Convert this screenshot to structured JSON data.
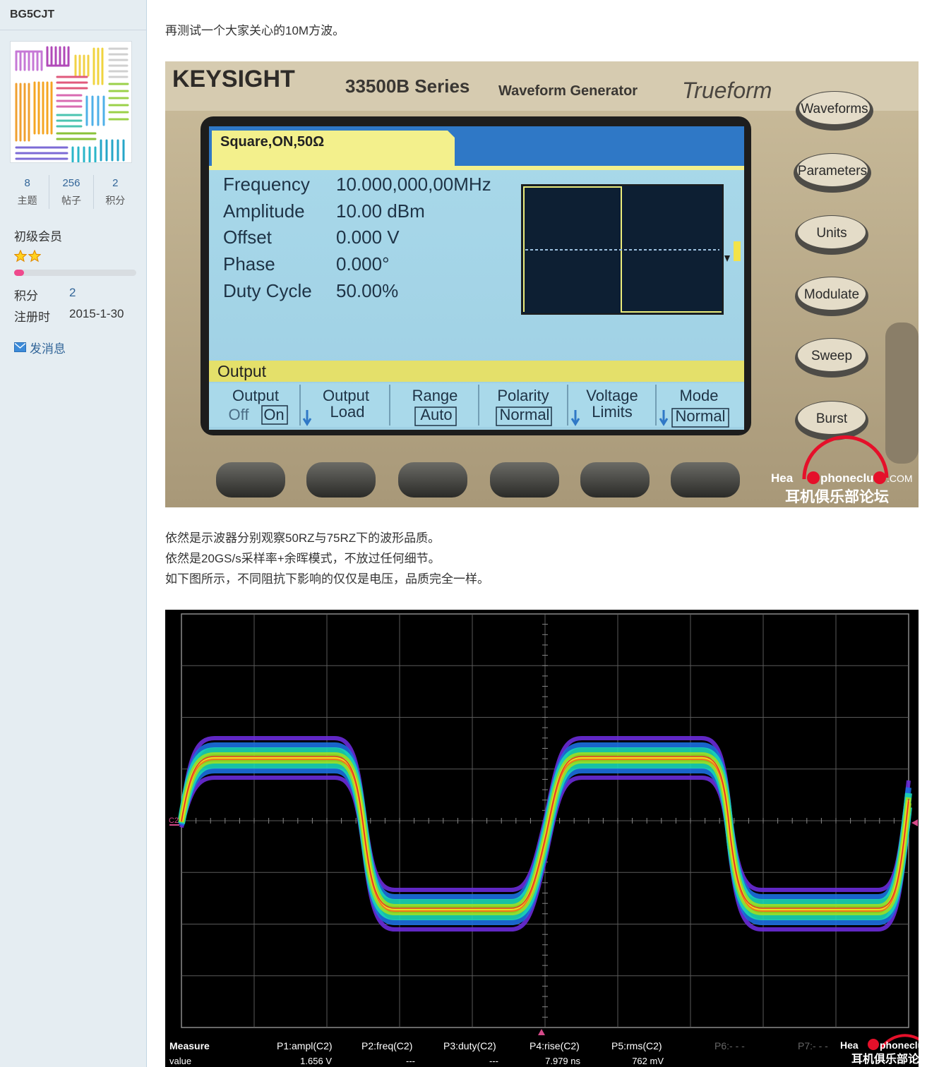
{
  "user": {
    "name": "BG5CJT",
    "stats": [
      {
        "value": "8",
        "label": "主题"
      },
      {
        "value": "256",
        "label": "帖子"
      },
      {
        "value": "2",
        "label": "积分"
      }
    ],
    "rank": "初级会员",
    "stars": 2,
    "rank_progress_percent": 8,
    "points_label": "积分",
    "points_value": "2",
    "register_label": "注册时",
    "register_value": "2015-1-30",
    "message_link": "发消息",
    "colors": {
      "link": "#336699",
      "progress": "#ef4a8d",
      "sidebar_bg": "#e5edf2"
    }
  },
  "post": {
    "intro": "再测试一个大家关心的10M方波。",
    "lines": [
      "依然是示波器分别观察50RZ与75RZ下的波形品质。",
      "依然是20GS/s采样率+余晖模式，不放过任何细节。",
      "如下图所示，不同阻抗下影响的仅仅是电压，品质完全一样。"
    ]
  },
  "generator_photo": {
    "brand": "KEYSIGHT",
    "series": "33500B Series",
    "model": "Waveform Generator",
    "trueform": "Trueform",
    "tab": "Square,ON,50Ω",
    "params": [
      {
        "name": "Frequency",
        "value": "10.000,000,00MHz"
      },
      {
        "name": "Amplitude",
        "value": "10.00 dBm"
      },
      {
        "name": "Offset",
        "value": "0.000 V"
      },
      {
        "name": "Phase",
        "value": "0.000°"
      },
      {
        "name": "Duty Cycle",
        "value": "50.00%"
      }
    ],
    "menu_title": "Output",
    "softkeys": [
      {
        "top": "Output",
        "bottom_a": "Off",
        "bottom_b": "On"
      },
      {
        "top": "Output",
        "bottom": "Load"
      },
      {
        "top": "Range",
        "bottom": "Auto"
      },
      {
        "top": "Polarity",
        "bottom": "Normal"
      },
      {
        "top": "Voltage",
        "bottom": "Limits"
      },
      {
        "top": "Mode",
        "bottom": "Normal"
      }
    ],
    "side_buttons": [
      "Waveforms",
      "Parameters",
      "Units",
      "Modulate",
      "Sweep",
      "Burst"
    ],
    "watermark_en_a": "Hea",
    "watermark_en_b": "phoneclu",
    "watermark_en_c": ".COM",
    "watermark_cn": "耳机俱乐部论坛"
  },
  "scope": {
    "channel_label": "C2",
    "measure_header": "Measure",
    "value_label": "value",
    "measurements": [
      {
        "name": "P1:ampl(C2)",
        "value": "1.656 V"
      },
      {
        "name": "P2:freq(C2)",
        "value": "---"
      },
      {
        "name": "P3:duty(C2)",
        "value": "---"
      },
      {
        "name": "P4:rise(C2)",
        "value": "7.979 ns"
      },
      {
        "name": "P5:rms(C2)",
        "value": "762 mV"
      },
      {
        "name": "P6:- - -",
        "value": ""
      },
      {
        "name": "P7:- - -",
        "value": ""
      }
    ],
    "watermark_en_a": "Hea",
    "watermark_en_b": "phoneclu",
    "watermark_cn": "耳机俱乐部论"
  }
}
